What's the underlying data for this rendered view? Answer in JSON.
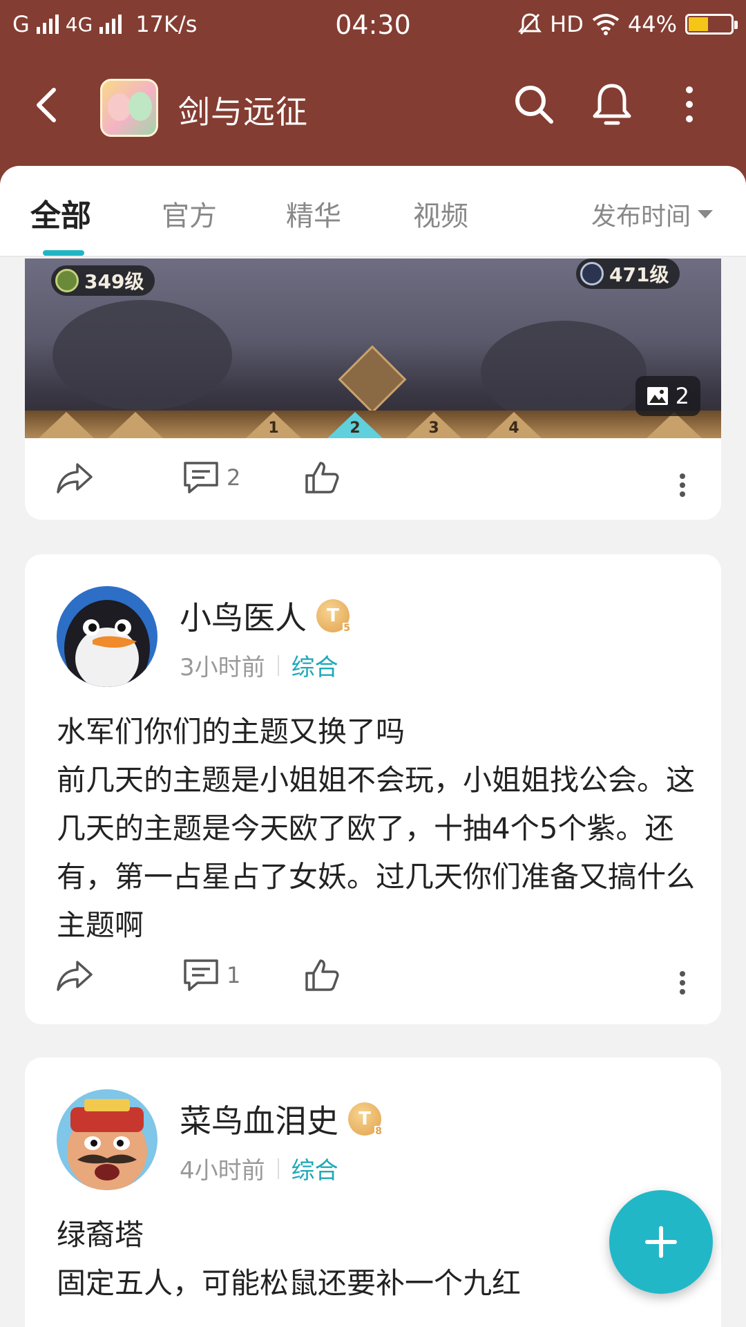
{
  "status_bar": {
    "carrier": "G",
    "network": "4G",
    "speed": "17K/s",
    "time": "04:30",
    "hd": "HD",
    "battery": "44%",
    "battery_level": 0.44
  },
  "app_bar": {
    "title": "剑与远征",
    "icons": [
      "back-arrow-icon",
      "app-icon",
      "search-icon",
      "bell-icon",
      "more-vertical-icon"
    ]
  },
  "tabs": {
    "items": [
      "全部",
      "官方",
      "精华",
      "视频"
    ],
    "active": "全部",
    "sort_label": "发布时间"
  },
  "colors": {
    "header": "#843d32",
    "accent": "#1fb5c4",
    "badge": "#e1a24e"
  },
  "posts": [
    {
      "image": {
        "left_level": "349级",
        "right_level": "471级",
        "image_count": "2",
        "slots": [
          "1",
          "2",
          "3",
          "4"
        ]
      },
      "comment_count": "2"
    },
    {
      "username": "小鸟医人",
      "badge_letter": "T",
      "badge_level": "5",
      "time": "3小时前",
      "category": "综合",
      "text": "水军们你们的主题又换了吗\n前几天的主题是小姐姐不会玩，小姐姐找公会。这几天的主题是今天欧了欧了，十抽4个5个紫。还有，第一占星占了女妖。过几天你们准备又搞什么主题啊",
      "comment_count": "1"
    },
    {
      "username": "菜鸟血泪史",
      "badge_letter": "T",
      "badge_level": "8",
      "time": "4小时前",
      "category": "综合",
      "text": "绿裔塔\n固定五人，可能松鼠还要补一个九红"
    }
  ]
}
